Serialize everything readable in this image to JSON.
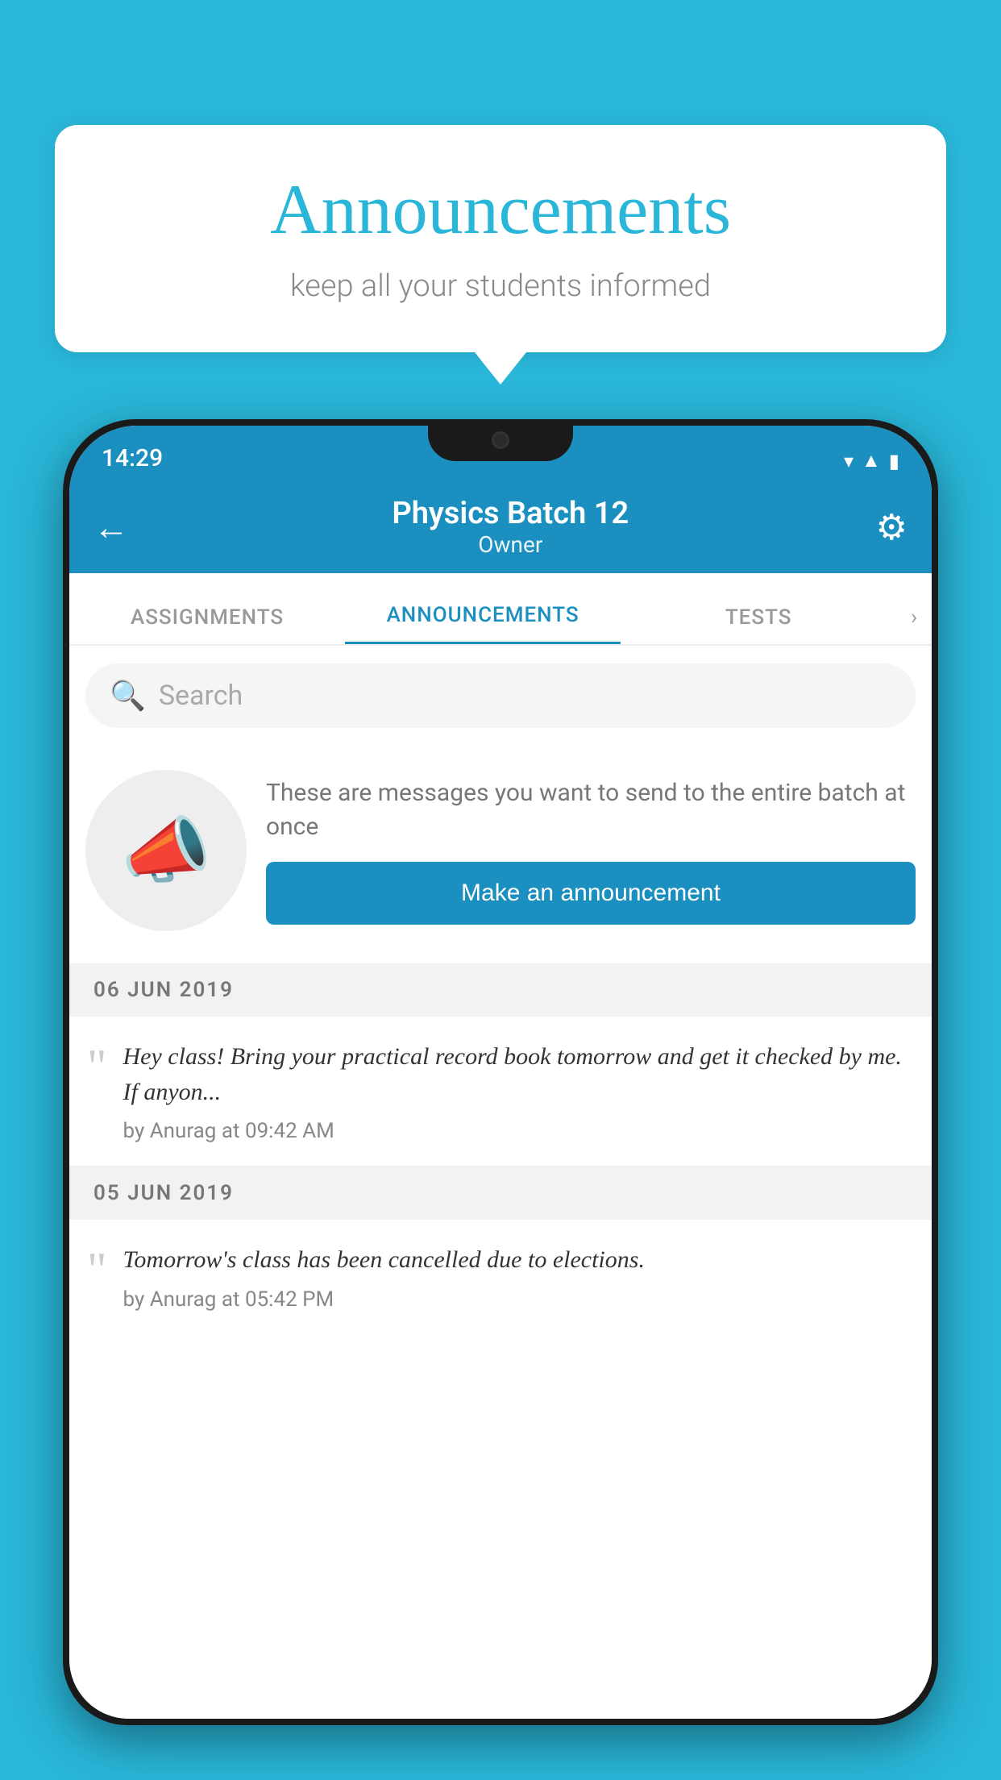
{
  "background_color": "#29b6d8",
  "speech_bubble": {
    "title": "Announcements",
    "subtitle": "keep all your students informed"
  },
  "status_bar": {
    "time": "14:29",
    "icons": [
      "wifi",
      "signal",
      "battery"
    ]
  },
  "app_bar": {
    "title": "Physics Batch 12",
    "subtitle": "Owner",
    "back_label": "←",
    "settings_label": "⚙"
  },
  "tabs": [
    {
      "label": "ASSIGNMENTS",
      "active": false
    },
    {
      "label": "ANNOUNCEMENTS",
      "active": true
    },
    {
      "label": "TESTS",
      "active": false
    },
    {
      "label": "›",
      "active": false
    }
  ],
  "search": {
    "placeholder": "Search"
  },
  "promo": {
    "description": "These are messages you want to send to the entire batch at once",
    "button_label": "Make an announcement"
  },
  "announcements": [
    {
      "date": "06  JUN  2019",
      "text": "Hey class! Bring your practical record book tomorrow and get it checked by me. If anyon...",
      "meta": "by Anurag at 09:42 AM"
    },
    {
      "date": "05  JUN  2019",
      "text": "Tomorrow's class has been cancelled due to elections.",
      "meta": "by Anurag at 05:42 PM"
    }
  ]
}
